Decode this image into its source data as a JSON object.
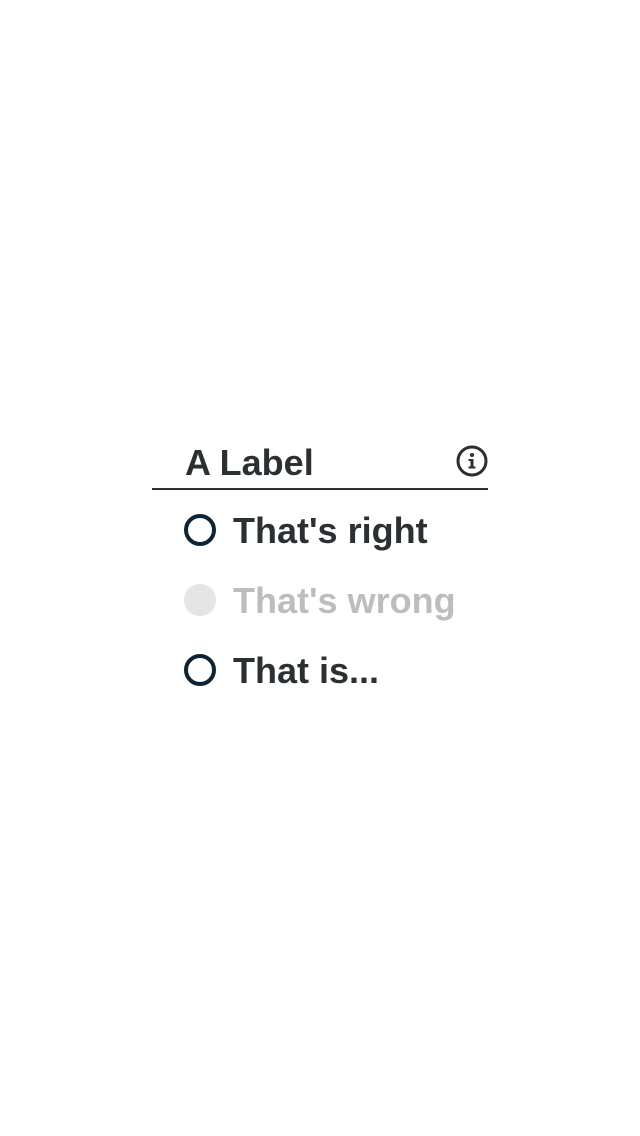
{
  "fieldset": {
    "label": "A Label",
    "info_icon": "info-circle-icon"
  },
  "options": [
    {
      "label": "That's right",
      "state": "enabled"
    },
    {
      "label": "That's wrong",
      "state": "disabled"
    },
    {
      "label": "That is...",
      "state": "enabled"
    }
  ],
  "colors": {
    "text": "#2b3033",
    "radio_border": "#0c2433",
    "disabled_text": "#bdbdbd",
    "disabled_fill": "#e5e5e5"
  }
}
